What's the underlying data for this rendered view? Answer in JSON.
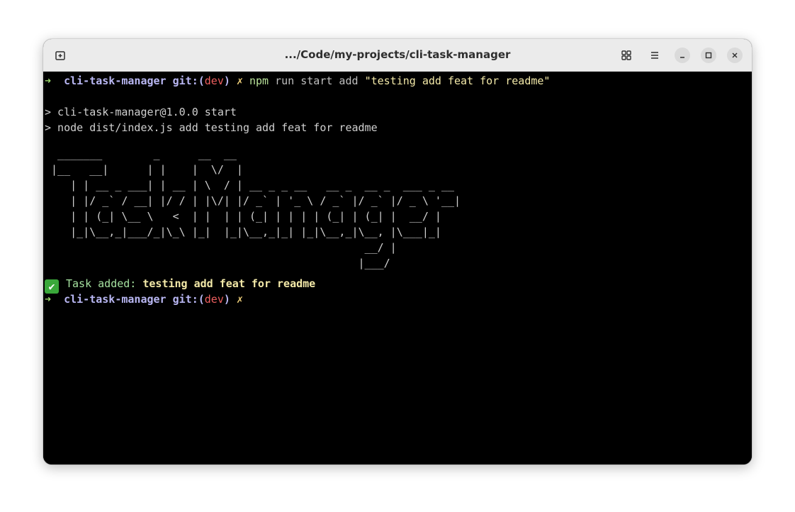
{
  "window": {
    "title": ".../Code/my-projects/cli-task-manager"
  },
  "icons": {
    "new_tab": "new-tab-icon",
    "grid": "grid-icon",
    "menu": "hamburger-menu-icon",
    "minimize": "minimize-icon",
    "maximize": "maximize-icon",
    "close": "close-icon"
  },
  "terminal": {
    "prompt1": {
      "arrow": "➜",
      "dir": "cli-task-manager",
      "git_prefix": "git:(",
      "branch": "dev",
      "git_suffix": ")",
      "dirty": "✗",
      "cmd": "npm",
      "args": "run start add",
      "quoted": "\"testing add feat for readme\""
    },
    "out1": "> cli-task-manager@1.0.0 start",
    "out2": "> node dist/index.js add testing add feat for readme",
    "ascii_art": "  _______        _      __  __                                   \n |__   __|      | |    |  \\/  |                                  \n    | | __ _ ___| | __ | \\  / | __ _ _ __   __ _  __ _  ___ _ __ \n    | |/ _` / __| |/ / | |\\/| |/ _` | '_ \\ / _` |/ _` |/ _ \\ '__|\n    | | (_| \\__ \\   <  | |  | | (_| | | | | (_| | (_| |  __/ |   \n    |_|\\__,_|___/_|\\_\\ |_|  |_|\\__,_|_| |_|\\__,_|\\__, |\\___|_|   \n                                                  __/ |          \n                                                 |___/           ",
    "task": {
      "check": "✔",
      "label": "Task added:",
      "value": "testing add feat for readme"
    },
    "prompt2": {
      "arrow": "➜",
      "dir": "cli-task-manager",
      "git_prefix": "git:(",
      "branch": "dev",
      "git_suffix": ")",
      "dirty": "✗"
    }
  }
}
